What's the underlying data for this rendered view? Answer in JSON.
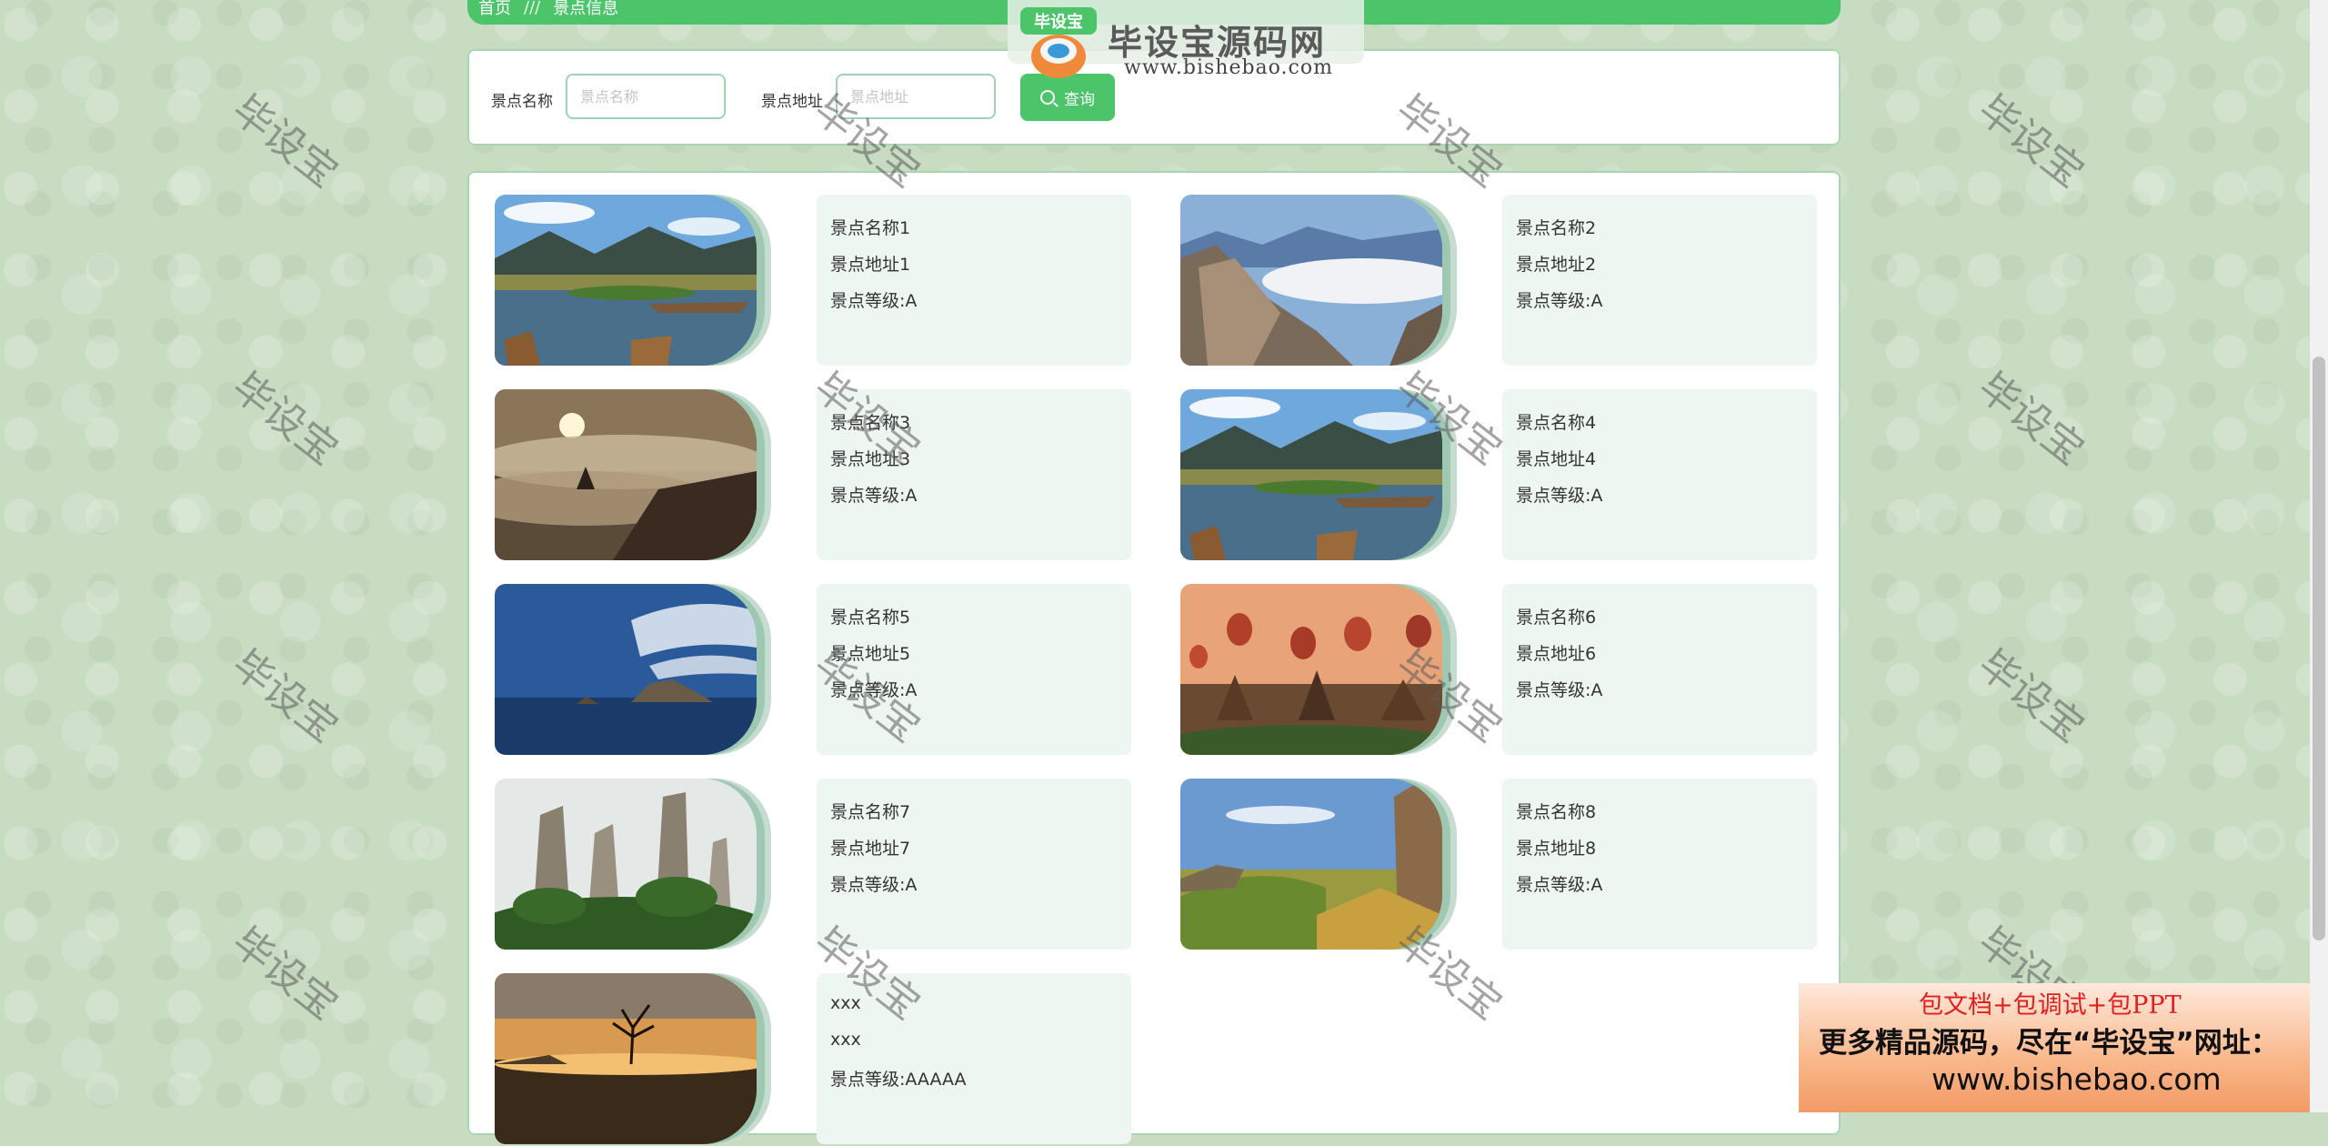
{
  "breadcrumb": {
    "home": "首页",
    "separator": "///",
    "current": "景点信息"
  },
  "search": {
    "name_label": "景点名称",
    "name_placeholder": "景点名称",
    "name_value": "",
    "address_label": "景点地址",
    "address_placeholder": "景点地址",
    "address_value": "",
    "button_label": "查询",
    "button_icon": "search-icon"
  },
  "spots": [
    {
      "name": "景点名称1",
      "address": "景点地址1",
      "level": "景点等级:A",
      "image": "lake-boats-mountains"
    },
    {
      "name": "景点名称2",
      "address": "景点地址2",
      "level": "景点等级:A",
      "image": "rocky-peaks-clouds"
    },
    {
      "name": "景点名称3",
      "address": "景点地址3",
      "level": "景点等级:A",
      "image": "sunrise-misty-cliff"
    },
    {
      "name": "景点名称4",
      "address": "景点地址4",
      "level": "景点等级:A",
      "image": "lake-boats-mountains"
    },
    {
      "name": "景点名称5",
      "address": "景点地址5",
      "level": "景点等级:A",
      "image": "sea-rock-island"
    },
    {
      "name": "景点名称6",
      "address": "景点地址6",
      "level": "景点等级:A",
      "image": "hot-air-balloons-temples"
    },
    {
      "name": "景点名称7",
      "address": "景点地址7",
      "level": "景点等级:A",
      "image": "karst-pillars-forest"
    },
    {
      "name": "景点名称8",
      "address": "景点地址8",
      "level": "景点等级:A",
      "image": "cliff-meadow-sunset"
    },
    {
      "name": "xxx",
      "address": "xxx",
      "level": "景点等级:AAAAA",
      "image": "lone-tree-lake-sunset"
    }
  ],
  "watermark": "毕设宝",
  "logo": {
    "title": "毕设宝源码网",
    "url": "www.bishebao.com",
    "badge": "毕设宝"
  },
  "ad": {
    "line1": "包文档+包调试+包PPT",
    "line2": "更多精品源码，尽在“毕设宝”网址：",
    "line3": "www.bishebao.com"
  },
  "colors": {
    "accent": "#4cc46a",
    "panel": "#ffffff",
    "info_bg": "#eef6f1",
    "page_bg": "#c8dcc2"
  }
}
